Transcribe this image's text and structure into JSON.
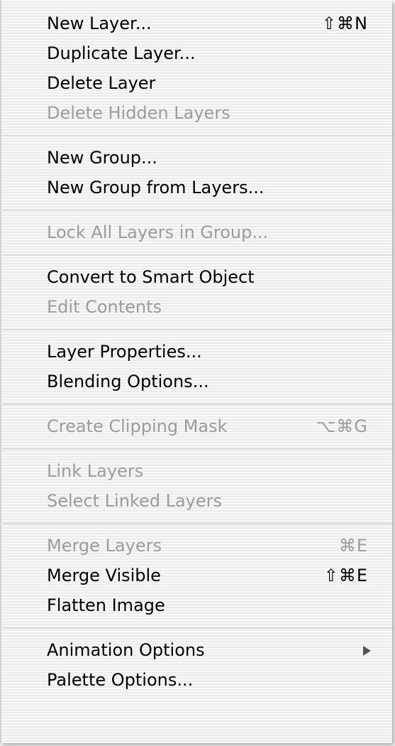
{
  "menu": {
    "items": [
      {
        "type": "item",
        "label": "New Layer...",
        "shortcut": "⇧⌘N",
        "enabled": true
      },
      {
        "type": "item",
        "label": "Duplicate Layer...",
        "enabled": true
      },
      {
        "type": "item",
        "label": "Delete Layer",
        "enabled": true
      },
      {
        "type": "item",
        "label": "Delete Hidden Layers",
        "enabled": false
      },
      {
        "type": "separator"
      },
      {
        "type": "item",
        "label": "New Group...",
        "enabled": true
      },
      {
        "type": "item",
        "label": "New Group from Layers...",
        "enabled": true
      },
      {
        "type": "separator"
      },
      {
        "type": "item",
        "label": "Lock All Layers in Group...",
        "enabled": false
      },
      {
        "type": "separator"
      },
      {
        "type": "item",
        "label": "Convert to Smart Object",
        "enabled": true
      },
      {
        "type": "item",
        "label": "Edit Contents",
        "enabled": false
      },
      {
        "type": "separator"
      },
      {
        "type": "item",
        "label": "Layer Properties...",
        "enabled": true
      },
      {
        "type": "item",
        "label": "Blending Options...",
        "enabled": true
      },
      {
        "type": "separator"
      },
      {
        "type": "item",
        "label": "Create Clipping Mask",
        "shortcut": "⌥⌘G",
        "enabled": false
      },
      {
        "type": "separator"
      },
      {
        "type": "item",
        "label": "Link Layers",
        "enabled": false
      },
      {
        "type": "item",
        "label": "Select Linked Layers",
        "enabled": false
      },
      {
        "type": "separator"
      },
      {
        "type": "item",
        "label": "Merge Layers",
        "shortcut": "⌘E",
        "enabled": false
      },
      {
        "type": "item",
        "label": "Merge Visible",
        "shortcut": "⇧⌘E",
        "enabled": true
      },
      {
        "type": "item",
        "label": "Flatten Image",
        "enabled": true
      },
      {
        "type": "separator"
      },
      {
        "type": "item",
        "label": "Animation Options",
        "submenu": true,
        "icon": "submenu-arrow-icon",
        "enabled": true
      },
      {
        "type": "item",
        "label": "Palette Options...",
        "enabled": true
      }
    ]
  },
  "colors": {
    "enabled_text": "#000000",
    "disabled_text": "#9c9c9c",
    "menu_background": "#f4f4f4",
    "separator": "#dcdcdc"
  }
}
